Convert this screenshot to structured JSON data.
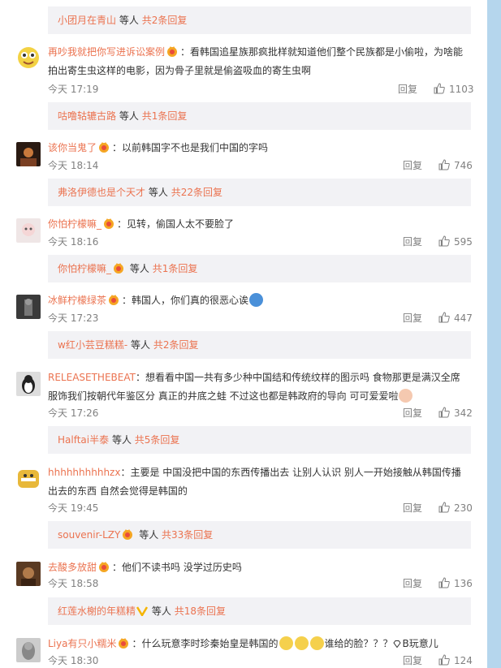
{
  "colors": {
    "username": "#eb7350",
    "meta": "#808080",
    "reply_bg": "#f2f2f5",
    "scrollbar": "#b5d6ed"
  },
  "icons": {
    "like": "thumbs-up-icon",
    "vip_badge": "vip-crown-badge-icon"
  },
  "reply_boxes": [
    {
      "user": "小团月在青山",
      "mid": "等人",
      "more": "共2条回复"
    },
    {
      "user": "咕噜轱辘古路",
      "mid": "等人",
      "more": "共1条回复"
    },
    {
      "user": "弗洛伊德也是个天才",
      "mid": "等人",
      "more": "共22条回复"
    },
    {
      "user": "你怕柠檬嘛_",
      "mid": "等人",
      "more": "共1条回复"
    },
    {
      "user": "w红小芸豆糕糕-",
      "mid": "等人",
      "more": "共2条回复"
    },
    {
      "user": "Halftai半泰",
      "mid": "等人",
      "more": "共5条回复"
    },
    {
      "user": "souvenir-LZY",
      "mid": "等人",
      "more": "共33条回复"
    },
    {
      "user": "红莲水榭的年糕精",
      "mid": "等人",
      "more": "共18条回复"
    }
  ],
  "comments": [
    {
      "user": "再吵我就把你写进诉讼案例",
      "text": "：看韩国追星族那疯批样就知道他们整个民族都是小偷啦，为啥能拍出寄生虫这样的电影，因为骨子里就是偷盗吸血的寄生虫啊",
      "time": "今天 17:19",
      "reply": "回复",
      "likes": "1103"
    },
    {
      "user": "该你当鬼了",
      "text": "：以前韩国字不也是我们中国的字吗",
      "time": "今天 18:14",
      "reply": "回复",
      "likes": "746"
    },
    {
      "user": "你怕柠檬嘛_",
      "text": "：见转，偷国人太不要脸了",
      "time": "今天 18:16",
      "reply": "回复",
      "likes": "595"
    },
    {
      "user": "冰鲜柠檬绿茶",
      "text": "：韩国人，你们真的很恶心诶",
      "time": "今天 17:23",
      "reply": "回复",
      "likes": "447"
    },
    {
      "user": "RELEASETHEBEAT",
      "text": "：想看看中国一共有多少种中国结和传统纹样的图示吗 食物那更是满汉全席 服饰我们按朝代年鉴区分 真正的井底之蛙 不过这也都是韩政府的导向 可可爱爱啦",
      "time": "今天 17:26",
      "reply": "回复",
      "likes": "342"
    },
    {
      "user": "hhhhhhhhhhzx",
      "text": "：主要是 中国没把中国的东西传播出去 让别人认识 别人一开始接触从韩国传播出去的东西 自然会觉得是韩国的",
      "time": "今天 19:45",
      "reply": "回复",
      "likes": "230"
    },
    {
      "user": "去酸多放甜",
      "text": "：他们不读书吗 没学过历史吗",
      "time": "今天 18:58",
      "reply": "回复",
      "likes": "136"
    },
    {
      "user": "Liya有只小糯米",
      "text": "：什么玩意李时珍秦始皇是韩国的",
      "text_tail": "谁给的脸？？？",
      "text_end": "B玩意儿",
      "time": "今天 18:30",
      "reply": "回复",
      "likes": "124"
    }
  ]
}
